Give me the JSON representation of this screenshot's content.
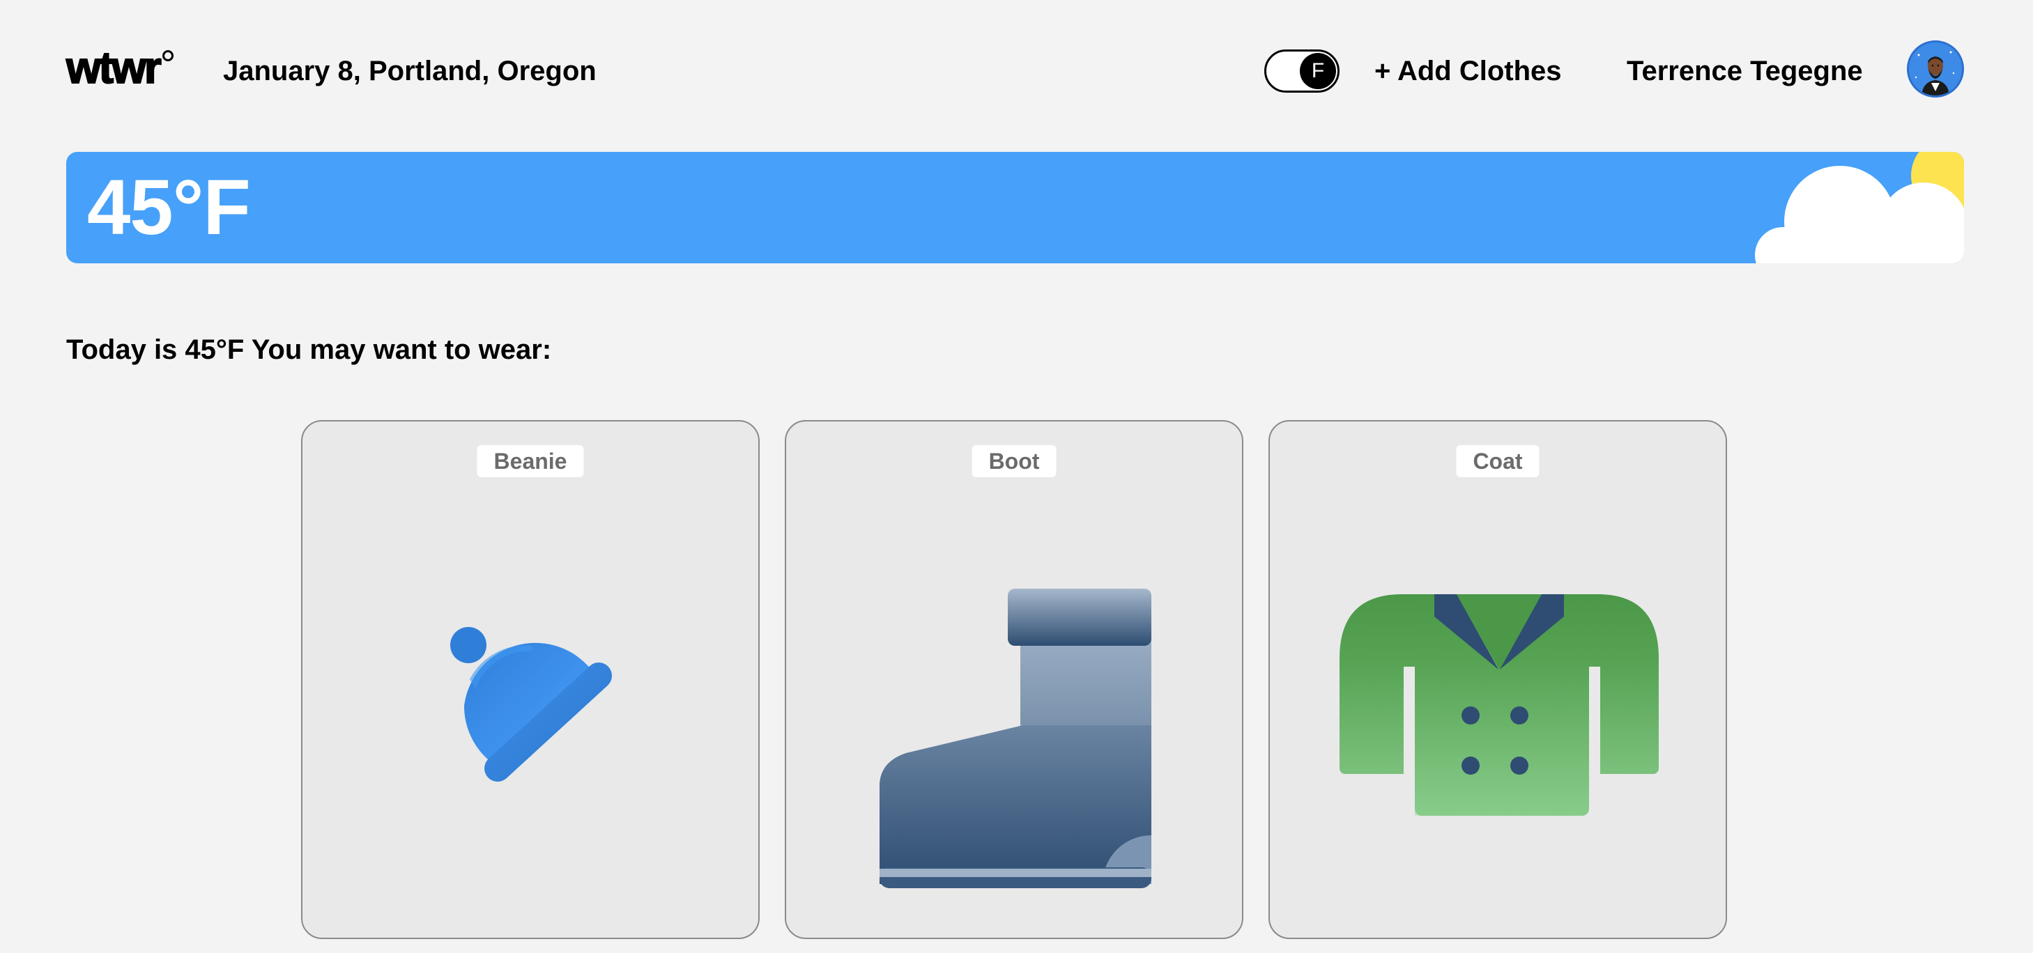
{
  "header": {
    "logo_text": "wtwr",
    "date_location": "January 8, Portland, Oregon",
    "toggle_unit": "F",
    "add_clothes_label": "+ Add Clothes",
    "user_name": "Terrence Tegegne"
  },
  "weather": {
    "temperature": "45°F",
    "condition_icons": [
      "cloud-icon",
      "sun-icon"
    ],
    "banner_color": "#47a0f9"
  },
  "recommendation": {
    "text": "Today is 45°F You may want to wear:"
  },
  "items": [
    {
      "label": "Beanie",
      "icon": "beanie-icon"
    },
    {
      "label": "Boot",
      "icon": "boot-icon"
    },
    {
      "label": "Coat",
      "icon": "coat-icon"
    }
  ]
}
